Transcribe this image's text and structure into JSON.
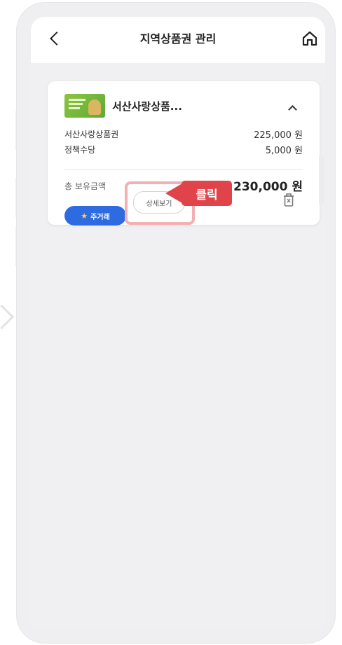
{
  "header": {
    "title": "지역상품권 관리",
    "back_icon": "chevron-left-icon",
    "home_icon": "home-icon"
  },
  "voucher_card": {
    "title": "서산사랑상품...",
    "rows": [
      {
        "label": "서산사랑상품권",
        "value": "225,000 원"
      },
      {
        "label": "정책수당",
        "value": "5,000 원"
      }
    ],
    "total_label": "총 보유금액",
    "total_value": "230,000 원",
    "favorite_label": "주거래",
    "detail_label": "상세보기"
  },
  "callout": {
    "label": "클릭",
    "color": "#e0444a"
  },
  "colors": {
    "accent": "#2f6be0",
    "highlight": "#f2b0b3"
  }
}
